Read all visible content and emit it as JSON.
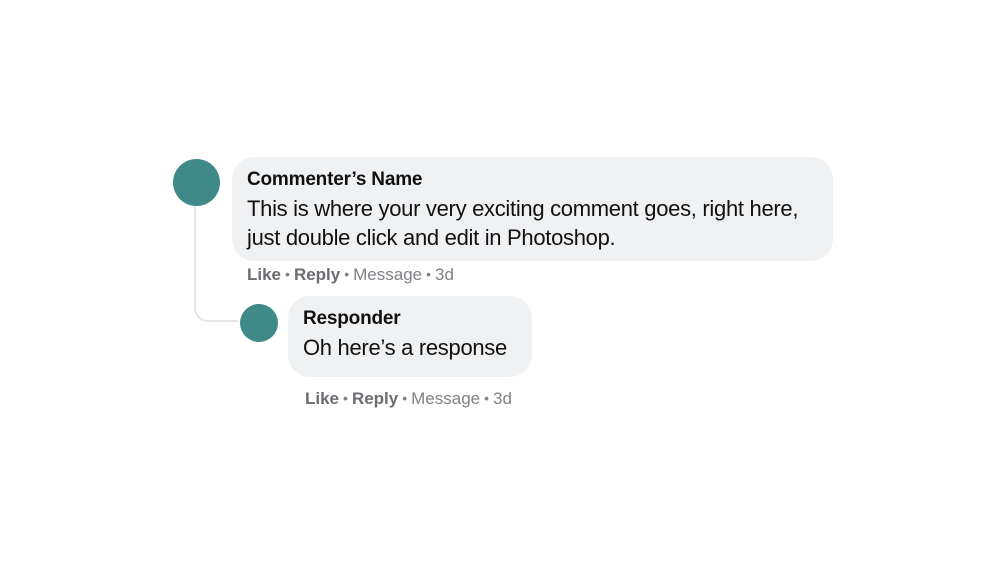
{
  "comment": {
    "author": "Commenter’s Name",
    "text": "This is where your very exciting comment goes, right here, just double click and edit in Photoshop.",
    "actions": {
      "like": "Like",
      "reply": "Reply",
      "message": "Message",
      "age": "3d"
    },
    "reply": {
      "author": "Responder",
      "text": "Oh here’s a response",
      "actions": {
        "like": "Like",
        "reply": "Reply",
        "message": "Message",
        "age": "3d"
      }
    }
  },
  "separator": "•",
  "colors": {
    "avatar": "#3f8a88",
    "bubble": "#f0f1f3",
    "connector": "#e4e6e9",
    "meta_text": "#7a7c80"
  }
}
